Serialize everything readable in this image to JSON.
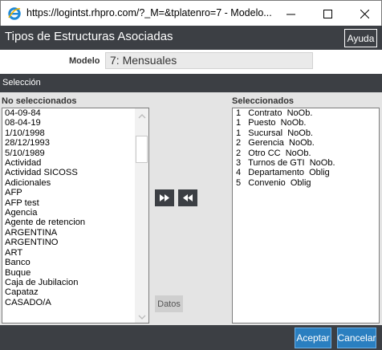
{
  "window": {
    "title": "https://logintst.rhpro.com/?_M=&tplatenro=7 - Modelo...",
    "minimize_icon": "minimize-icon",
    "maximize_icon": "maximize-icon",
    "close_icon": "close-icon"
  },
  "header": {
    "title": "Tipos de Estructuras Asociadas",
    "help_label": "Ayuda"
  },
  "model": {
    "label": "Modelo",
    "value": "7: Mensuales"
  },
  "section": {
    "label": "Selección"
  },
  "left_list": {
    "label": "No seleccionados",
    "items": [
      "04-09-84",
      "08-04-19",
      "1/10/1998",
      "28/12/1993",
      "5/10/1989",
      "Actividad",
      "Actividad SICOSS",
      "Adicionales",
      "AFP",
      "AFP test",
      "Agencia",
      "Agente de retencion",
      "ARGENTINA",
      "ARGENTINO",
      "ART",
      "Banco",
      "Buque",
      "Caja de Jubilacion",
      "Capataz",
      "CASADO/A"
    ]
  },
  "right_list": {
    "label": "Seleccionados",
    "items": [
      "1   Contrato  NoOb.",
      "1   Puesto  NoOb.",
      "1   Sucursal  NoOb.",
      "2   Gerencia  NoOb.",
      "2   Otro CC  NoOb.",
      "3   Turnos de GTI  NoOb.",
      "4   Departamento  Oblig",
      "5   Convenio  Oblig"
    ]
  },
  "actions": {
    "add_icon": "fast-forward-icon",
    "remove_icon": "rewind-icon",
    "datos_label": "Datos"
  },
  "footer": {
    "accept_label": "Aceptar",
    "cancel_label": "Cancelar"
  },
  "colors": {
    "dark_bar": "#3c3f44",
    "accent": "#2a7fc0",
    "panel": "#e4e4e4"
  }
}
